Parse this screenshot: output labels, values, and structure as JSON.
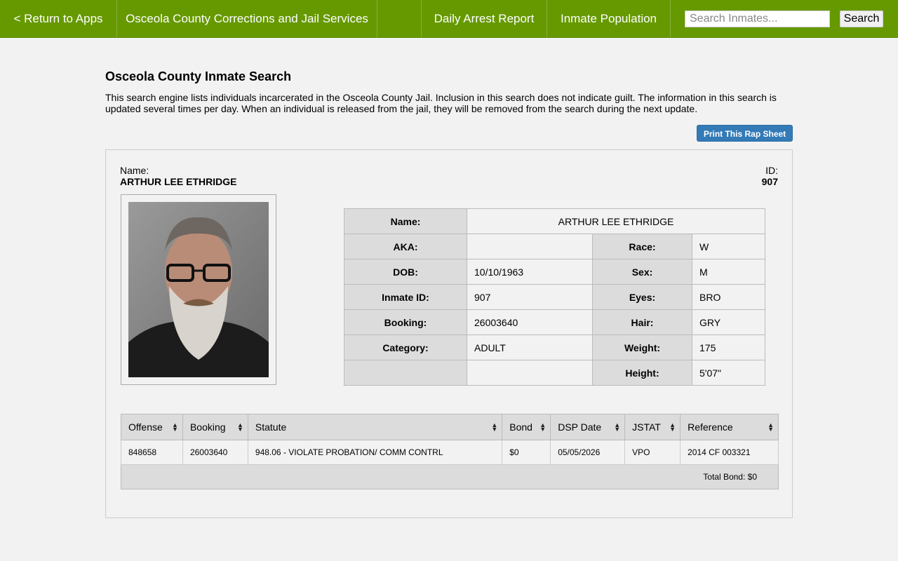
{
  "nav": {
    "return_label": "< Return to Apps",
    "title": "Osceola County Corrections and Jail Services",
    "daily_arrest": "Daily Arrest Report",
    "inmate_population": "Inmate Population",
    "search_placeholder": "Search Inmates...",
    "search_button": "Search",
    "color": "#669900"
  },
  "page": {
    "title": "Osceola County Inmate Search",
    "intro": "This search engine lists individuals incarcerated in the Osceola County Jail. Inclusion in this search does not indicate guilt. The information in this search is updated several times per day. When an individual is released from the jail, they will be removed from the search during the next update.",
    "print_button": "Print This Rap Sheet",
    "print_button_color": "#337ab7"
  },
  "inmate": {
    "name_label": "Name:",
    "name": "ARTHUR LEE ETHRIDGE",
    "id_label": "ID:",
    "id": "907",
    "details": {
      "name_label": "Name:",
      "name": "ARTHUR LEE ETHRIDGE",
      "aka_label": "AKA:",
      "aka": "",
      "race_label": "Race:",
      "race": "W",
      "dob_label": "DOB:",
      "dob": "10/10/1963",
      "sex_label": "Sex:",
      "sex": "M",
      "inmate_id_label": "Inmate ID:",
      "inmate_id": "907",
      "eyes_label": "Eyes:",
      "eyes": "BRO",
      "booking_label": "Booking:",
      "booking": "26003640",
      "hair_label": "Hair:",
      "hair": "GRY",
      "category_label": "Category:",
      "category": "ADULT",
      "weight_label": "Weight:",
      "weight": "175",
      "height_label": "Height:",
      "height": "5'07\""
    }
  },
  "offenses": {
    "headers": [
      "Offense",
      "Booking",
      "Statute",
      "Bond",
      "DSP Date",
      "JSTAT",
      "Reference"
    ],
    "rows": [
      [
        "848658",
        "26003640",
        "948.06 - VIOLATE PROBATION/ COMM CONTRL",
        "$0",
        "05/05/2026",
        "VPO",
        "2014 CF 003321"
      ]
    ],
    "total_bond": "Total Bond: $0"
  }
}
